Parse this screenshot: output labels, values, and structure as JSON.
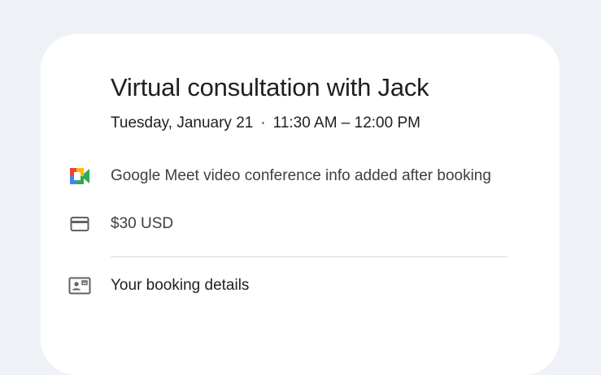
{
  "event": {
    "title": "Virtual consultation with Jack",
    "date": "Tuesday, January 21",
    "separator": "·",
    "time": "11:30 AM – 12:00 PM"
  },
  "details": {
    "conference": {
      "icon": "google-meet-icon",
      "text": "Google Meet video conference info added after booking"
    },
    "payment": {
      "icon": "credit-card-icon",
      "text": "$30 USD"
    }
  },
  "booking": {
    "icon": "contact-card-icon",
    "label": "Your booking details"
  },
  "colors": {
    "background": "#eef2f7",
    "card": "#ffffff",
    "text_primary": "#1f1f1f",
    "text_secondary": "#3c4043",
    "icon_gray": "#5f6368",
    "divider": "#dadce0",
    "meet_blue": "#4285f4",
    "meet_green": "#34a853",
    "meet_yellow": "#fbbc04",
    "meet_red": "#ea4335"
  }
}
